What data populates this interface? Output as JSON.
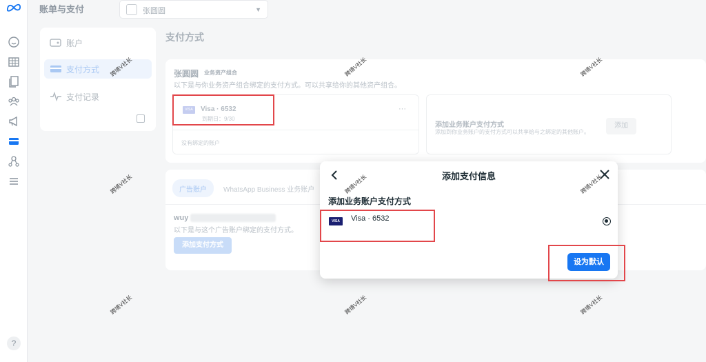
{
  "header": {
    "title": "账单与支付",
    "business_name": "张圆圆"
  },
  "sidenav": {
    "items": [
      {
        "label": "账户",
        "icon": "wallet-icon"
      },
      {
        "label": "支付方式",
        "icon": "card-icon"
      },
      {
        "label": "支付记录",
        "icon": "activity-icon"
      }
    ]
  },
  "page": {
    "title": "支付方式"
  },
  "portfolio": {
    "name": "张圆圆",
    "tag": "业务资产组合",
    "description": "以下是与你业务资产组合绑定的支付方式。可以共享给你的其他资产组合。",
    "card_label": "Visa · 6532",
    "expiry": "到期日：9/30",
    "more": "···",
    "no_accounts": "没有绑定的账户",
    "add_title": "添加业务账户支付方式",
    "add_desc": "添加到你业务账户的支付方式可以共享给与之绑定的其他账户。",
    "add_button": "添加"
  },
  "accounts": {
    "tabs": [
      "广告账户",
      "WhatsApp Business 业务账户"
    ],
    "account_name": "wuy",
    "description": "以下是与这个广告账户绑定的支付方式。",
    "add_button": "添加支付方式"
  },
  "dialog": {
    "title": "添加支付信息",
    "section": "添加业务账户支付方式",
    "card_label": "Visa · 6532",
    "visa_logo": "VISA",
    "set_default": "设为默认"
  },
  "rail": {
    "help": "?"
  },
  "watermark": "跨境V社长",
  "colors": {
    "accent": "#1877f2",
    "highlight": "#e2464a"
  }
}
